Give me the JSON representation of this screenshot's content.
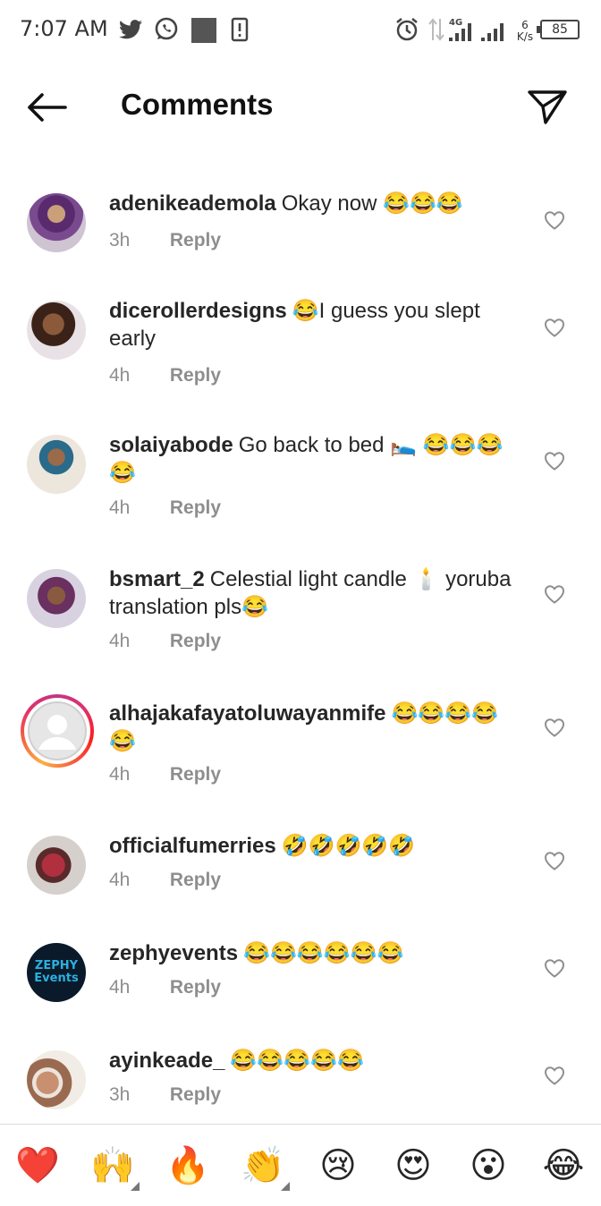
{
  "status_bar": {
    "time": "7:07 AM",
    "icons": [
      "twitter-icon",
      "whatsapp-icon",
      "notification-square-icon",
      "sim-alert-icon",
      "alarm-icon",
      "data-transfer-icon",
      "signal-4g-icon",
      "signal-icon"
    ],
    "network_label": "4G",
    "speed_value": "6",
    "speed_unit": "K/s",
    "battery": "85"
  },
  "header": {
    "title": "Comments",
    "back_icon": "arrow-left-icon",
    "share_icon": "send-icon"
  },
  "comments": [
    {
      "username": "adenikeademola",
      "text": "Okay now 😂😂😂",
      "time": "3h",
      "reply": "Reply"
    },
    {
      "username": "dicerollerdesigns",
      "text": "😂I guess you slept early",
      "time": "4h",
      "reply": "Reply"
    },
    {
      "username": "solaiyabode",
      "text": "Go back to bed 🛌 😂😂😂😂",
      "time": "4h",
      "reply": "Reply"
    },
    {
      "username": "bsmart_2",
      "text": "Celestial light candle 🕯️ yoruba translation pls😂",
      "time": "4h",
      "reply": "Reply"
    },
    {
      "username": "alhajakafayatoluwayanmife",
      "text": "😂😂😂😂😂",
      "time": "4h",
      "reply": "Reply"
    },
    {
      "username": "officialfumerries",
      "text": "🤣🤣🤣🤣🤣",
      "time": "4h",
      "reply": "Reply"
    },
    {
      "username": "zephyevents",
      "text": "😂😂😂😂😂😂",
      "time": "4h",
      "reply": "Reply"
    },
    {
      "username": "ayinkeade_",
      "text": "😂😂😂😂😂",
      "time": "3h",
      "reply": "Reply"
    }
  ],
  "avatar_logo_text": "ZEPHY Events",
  "reactions": [
    "❤️",
    "🙌",
    "🔥",
    "👏",
    "😢",
    "😍",
    "😮",
    "😂"
  ],
  "colors": {
    "text": "#262626",
    "secondary": "#8e8e8e",
    "story_ring": "#e1306c"
  }
}
